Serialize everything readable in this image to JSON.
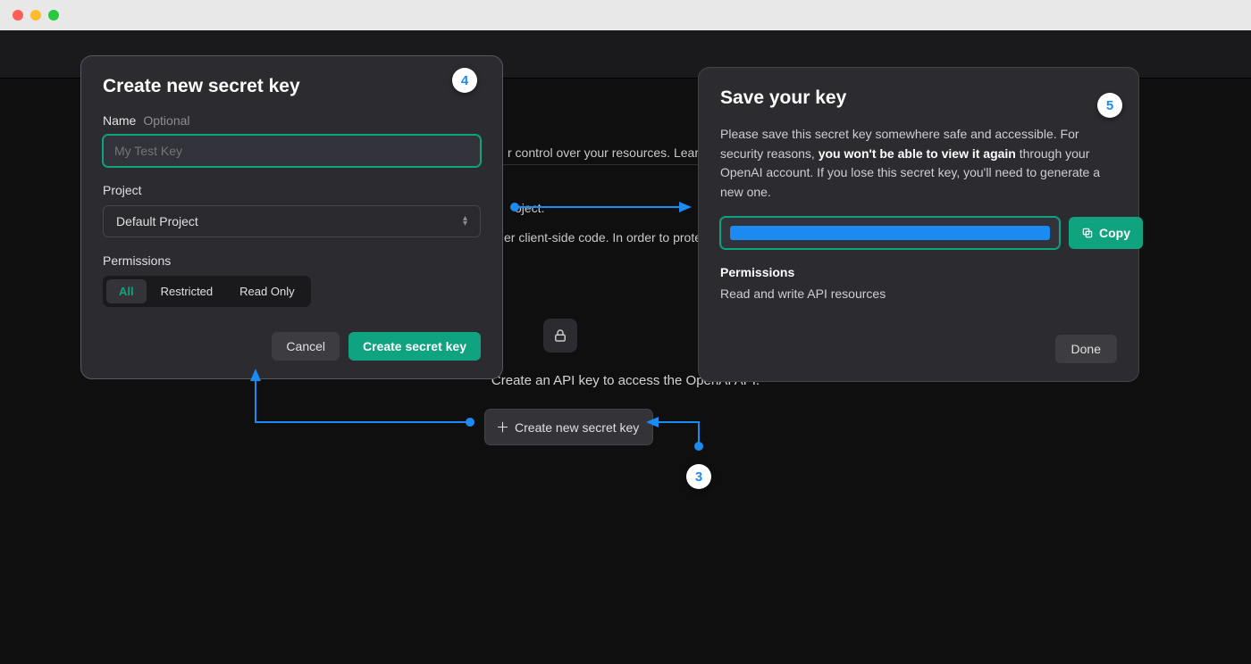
{
  "background": {
    "line1_suffix": "r control over your resources.",
    "learn": "Learn",
    "line2_suffix": "oject.",
    "line3_suffix": "er client-side code. In order to prote",
    "prompt": "Create an API key to access the OpenAI API.",
    "create_button": "Create new secret key"
  },
  "dialog_create": {
    "title": "Create new secret key",
    "name_label": "Name",
    "name_optional": "Optional",
    "name_placeholder": "My Test Key",
    "project_label": "Project",
    "project_value": "Default Project",
    "permissions_label": "Permissions",
    "perm_all": "All",
    "perm_restricted": "Restricted",
    "perm_readonly": "Read Only",
    "cancel": "Cancel",
    "submit": "Create secret key"
  },
  "dialog_save": {
    "title": "Save your key",
    "desc_a": "Please save this secret key somewhere safe and accessible. For security reasons, ",
    "desc_b": "you won't be able to view it again",
    "desc_c": " through your OpenAI account. If you lose this secret key, you'll need to generate a new one.",
    "copy": "Copy",
    "permissions_title": "Permissions",
    "permissions_desc": "Read and write API resources",
    "done": "Done"
  },
  "annotations": {
    "step3": "3",
    "step4": "4",
    "step5": "5"
  }
}
